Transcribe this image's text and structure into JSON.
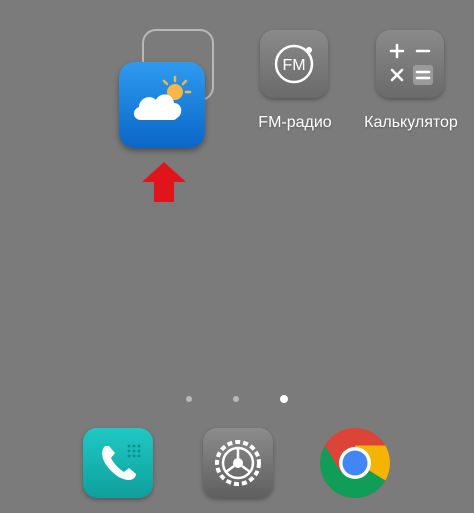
{
  "home_screen": {
    "apps": [
      {
        "label": "FM-радио",
        "icon": "fm-radio-icon"
      },
      {
        "label": "Калькулятор",
        "icon": "calculator-icon"
      }
    ],
    "dragged_app": {
      "icon": "weather-icon",
      "placeholder": "empty-slot-outline"
    },
    "arrow": {
      "icon": "red-up-arrow-icon",
      "color": "#e1141b"
    },
    "page_indicator": {
      "pages": 3,
      "active_page": 3
    },
    "dock": [
      {
        "icon": "phone-icon"
      },
      {
        "icon": "settings-gear-icon"
      },
      {
        "icon": "chrome-icon"
      }
    ]
  },
  "colors": {
    "background": "#7b7b7b",
    "weather_blue": "#1a7fd8",
    "phone_teal": "#15b8b4",
    "grey_icon": "#707070"
  }
}
